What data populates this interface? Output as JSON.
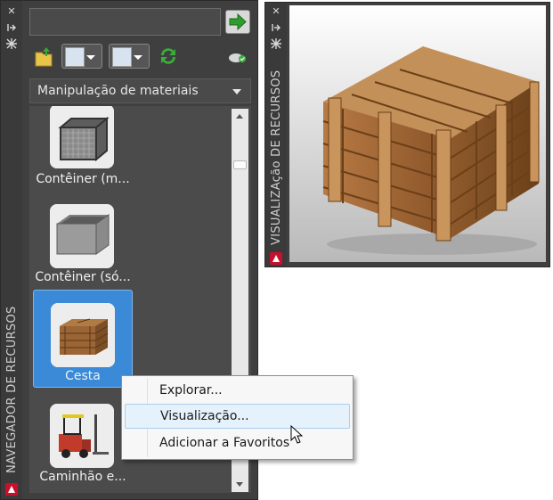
{
  "navigator": {
    "title": "NAVEGADOR DE RECURSOS",
    "search_value": "",
    "category": "Manipulação de materiais",
    "items": [
      {
        "label": "Contêiner (m..."
      },
      {
        "label": "Contêiner (só..."
      },
      {
        "label": "Cesta"
      },
      {
        "label": "Caminhão e..."
      }
    ]
  },
  "preview": {
    "title": "VISUALIZAção DE RECURSOS"
  },
  "context_menu": {
    "items": [
      {
        "label": "Explorar..."
      },
      {
        "label": "Visualização..."
      },
      {
        "label": "Adicionar a Favoritos"
      }
    ]
  },
  "colors": {
    "palette_bg": "#3f3f3f",
    "selection": "#3b8ad8",
    "brand": "#c8102e",
    "go_arrow": "#2e9d2e"
  },
  "icons": {
    "close": "close-icon",
    "autohide": "autohide-icon",
    "properties": "properties-icon"
  }
}
